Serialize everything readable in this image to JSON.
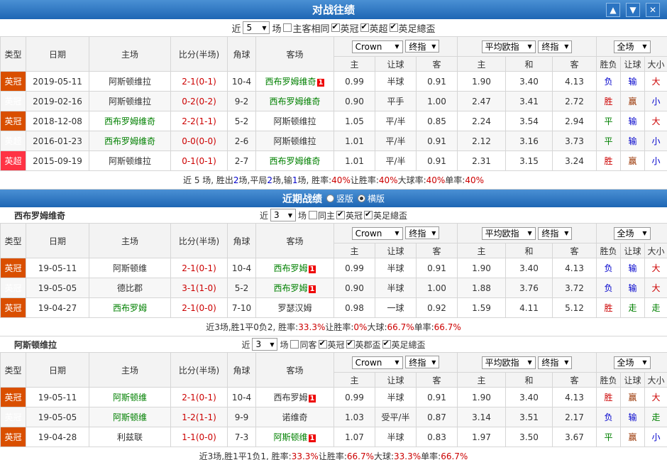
{
  "header": {
    "title": "对战往绩"
  },
  "h2h_controls": {
    "prefix": "近",
    "count": "5",
    "suffix": "场",
    "checks": [
      {
        "label": "主客相同",
        "checked": false
      },
      {
        "label": "英冠",
        "checked": true
      },
      {
        "label": "英超",
        "checked": true
      },
      {
        "label": "英足總盃",
        "checked": true
      }
    ]
  },
  "columns": {
    "type": "类型",
    "date": "日期",
    "home": "主场",
    "score": "比分(半场)",
    "corner": "角球",
    "away": "客场",
    "company": "Crown",
    "final1": "终指",
    "euro": "平均欧指",
    "final2": "终指",
    "scope": "全场",
    "sub": [
      "主",
      "让球",
      "客",
      "主",
      "和",
      "客",
      "胜负",
      "让球",
      "大小"
    ]
  },
  "h2h_rows": [
    {
      "league": "英冠",
      "lc": "lg-orange",
      "date": "2019-05-11",
      "home": "阿斯顿维拉",
      "hc": "",
      "score": "2-1(0-1)",
      "away": "西布罗姆维奇",
      "ac": "green",
      "rank": "1",
      "corner": "10-4",
      "o1": "0.99",
      "hcp": "半球",
      "o2": "0.91",
      "e1": "1.90",
      "e2": "3.40",
      "e3": "4.13",
      "r": "负",
      "rc": "blue",
      "rh": "输",
      "rhc": "blue",
      "ou": "大",
      "ouc": "red"
    },
    {
      "league": "英冠",
      "lc": "lg-orange",
      "date": "2019-02-16",
      "home": "阿斯顿维拉",
      "hc": "",
      "score": "0-2(0-2)",
      "away": "西布罗姆维奇",
      "ac": "green",
      "rank": "",
      "corner": "9-2",
      "o1": "0.90",
      "hcp": "平手",
      "o2": "1.00",
      "e1": "2.47",
      "e2": "3.41",
      "e3": "2.72",
      "r": "胜",
      "rc": "red",
      "rh": "赢",
      "rhc": "brown",
      "ou": "小",
      "ouc": "blue"
    },
    {
      "league": "英冠",
      "lc": "lg-orange",
      "date": "2018-12-08",
      "home": "西布罗姆维奇",
      "hc": "green",
      "score": "2-2(1-1)",
      "away": "阿斯顿维拉",
      "ac": "",
      "rank": "",
      "corner": "5-2",
      "o1": "1.05",
      "hcp": "平/半",
      "o2": "0.85",
      "e1": "2.24",
      "e2": "3.54",
      "e3": "2.94",
      "r": "平",
      "rc": "green",
      "rh": "输",
      "rhc": "blue",
      "ou": "大",
      "ouc": "red"
    },
    {
      "league": "英超",
      "lc": "lg-pink",
      "date": "2016-01-23",
      "home": "西布罗姆维奇",
      "hc": "green",
      "score": "0-0(0-0)",
      "away": "阿斯顿维拉",
      "ac": "",
      "rank": "",
      "corner": "2-6",
      "o1": "1.01",
      "hcp": "平/半",
      "o2": "0.91",
      "e1": "2.12",
      "e2": "3.16",
      "e3": "3.73",
      "r": "平",
      "rc": "green",
      "rh": "输",
      "rhc": "blue",
      "ou": "小",
      "ouc": "blue"
    },
    {
      "league": "英超",
      "lc": "lg-pink",
      "date": "2015-09-19",
      "home": "阿斯顿维拉",
      "hc": "",
      "score": "0-1(0-1)",
      "away": "西布罗姆维奇",
      "ac": "green",
      "rank": "",
      "corner": "2-7",
      "o1": "1.01",
      "hcp": "平/半",
      "o2": "0.91",
      "e1": "2.31",
      "e2": "3.15",
      "e3": "3.24",
      "r": "胜",
      "rc": "red",
      "rh": "赢",
      "rhc": "brown",
      "ou": "小",
      "ouc": "blue"
    }
  ],
  "h2h_summary": {
    "p1": "近 5 场, 胜出 ",
    "v1": "2",
    "p2": " 场,平局 ",
    "v2": "2",
    "p3": " 场,输 ",
    "v3": "1",
    "p4": " 场, 胜率: ",
    "v4": "40%",
    "p5": " 让胜率: ",
    "v5": "40%",
    "p6": " 大球率: ",
    "v6": "40%",
    "p7": " 单率: ",
    "v7": "40%"
  },
  "recent": {
    "title": "近期战绩",
    "opt1": "竖版",
    "opt2": "横版"
  },
  "team1": {
    "name": "西布罗姆维奇",
    "prefix": "近",
    "count": "3",
    "suffix": "场",
    "checks": [
      {
        "label": "同主",
        "checked": false
      },
      {
        "label": "英冠",
        "checked": true
      },
      {
        "label": "英足總盃",
        "checked": true
      }
    ],
    "rows": [
      {
        "league": "英冠",
        "lc": "lg-orange",
        "date": "19-05-11",
        "home": "阿斯顿维",
        "hc": "",
        "score": "2-1(0-1)",
        "away": "西布罗姆",
        "ac": "green",
        "rank": "1",
        "corner": "10-4",
        "o1": "0.99",
        "hcp": "半球",
        "o2": "0.91",
        "e1": "1.90",
        "e2": "3.40",
        "e3": "4.13",
        "r": "负",
        "rc": "blue",
        "rh": "输",
        "rhc": "blue",
        "ou": "大",
        "ouc": "red"
      },
      {
        "league": "英冠",
        "lc": "lg-orange",
        "date": "19-05-05",
        "home": "德比郡",
        "hc": "",
        "score": "3-1(1-0)",
        "away": "西布罗姆",
        "ac": "green",
        "rank": "1",
        "corner": "5-2",
        "o1": "0.90",
        "hcp": "半球",
        "o2": "1.00",
        "e1": "1.88",
        "e2": "3.76",
        "e3": "3.72",
        "r": "负",
        "rc": "blue",
        "rh": "输",
        "rhc": "blue",
        "ou": "大",
        "ouc": "red"
      },
      {
        "league": "英冠",
        "lc": "lg-orange",
        "date": "19-04-27",
        "home": "西布罗姆",
        "hc": "green",
        "score": "2-1(0-0)",
        "away": "罗瑟汉姆",
        "ac": "",
        "rank": "",
        "corner": "7-10",
        "o1": "0.98",
        "hcp": "一球",
        "o2": "0.92",
        "e1": "1.59",
        "e2": "4.11",
        "e3": "5.12",
        "r": "胜",
        "rc": "red",
        "rh": "走",
        "rhc": "green",
        "ou": "走",
        "ouc": "green"
      }
    ],
    "summary": {
      "p1": "近3场,胜1平0负2, 胜率:",
      "v1": "33.3%",
      "p2": " 让胜率:",
      "v2": "0%",
      "p3": " 大球:",
      "v3": "66.7%",
      "p4": " 单率:",
      "v4": "66.7%"
    }
  },
  "team2": {
    "name": "阿斯顿维拉",
    "prefix": "近",
    "count": "3",
    "suffix": "场",
    "checks": [
      {
        "label": "同客",
        "checked": false
      },
      {
        "label": "英冠",
        "checked": true
      },
      {
        "label": "英郡盃",
        "checked": true
      },
      {
        "label": "英足總盃",
        "checked": true
      }
    ],
    "rows": [
      {
        "league": "英冠",
        "lc": "lg-orange",
        "date": "19-05-11",
        "home": "阿斯顿维",
        "hc": "green",
        "score": "2-1(0-1)",
        "away": "西布罗姆",
        "ac": "",
        "rank": "1",
        "corner": "10-4",
        "o1": "0.99",
        "hcp": "半球",
        "o2": "0.91",
        "e1": "1.90",
        "e2": "3.40",
        "e3": "4.13",
        "r": "胜",
        "rc": "red",
        "rh": "赢",
        "rhc": "brown",
        "ou": "大",
        "ouc": "red"
      },
      {
        "league": "英冠",
        "lc": "lg-orange",
        "date": "19-05-05",
        "home": "阿斯顿维",
        "hc": "green",
        "score": "1-2(1-1)",
        "away": "诺维奇",
        "ac": "",
        "rank": "",
        "corner": "9-9",
        "o1": "1.03",
        "hcp": "受平/半",
        "o2": "0.87",
        "e1": "3.14",
        "e2": "3.51",
        "e3": "2.17",
        "r": "负",
        "rc": "blue",
        "rh": "输",
        "rhc": "blue",
        "ou": "走",
        "ouc": "green"
      },
      {
        "league": "英冠",
        "lc": "lg-orange",
        "date": "19-04-28",
        "home": "利兹联",
        "hc": "",
        "score": "1-1(0-0)",
        "away": "阿斯顿维",
        "ac": "green",
        "rank": "1",
        "corner": "7-3",
        "o1": "1.07",
        "hcp": "半球",
        "o2": "0.83",
        "e1": "1.97",
        "e2": "3.50",
        "e3": "3.67",
        "r": "平",
        "rc": "green",
        "rh": "赢",
        "rhc": "brown",
        "ou": "小",
        "ouc": "blue"
      }
    ],
    "summary": {
      "p1": "近3场,胜1平1负1, 胜率:",
      "v1": "33.3%",
      "p2": " 让胜率:",
      "v2": "66.7%",
      "p3": " 大球:",
      "v3": "33.3%",
      "p4": " 单率:",
      "v4": "66.7%"
    }
  }
}
